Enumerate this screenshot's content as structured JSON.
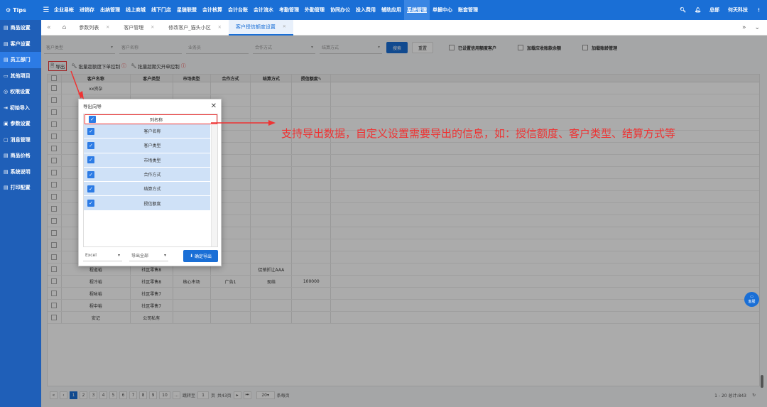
{
  "topbar": {
    "brand": "Tips",
    "nav": [
      "企业易帐",
      "进销存",
      "出纳管理",
      "线上商城",
      "线下门店",
      "星链联盟",
      "会计核算",
      "会计台账",
      "会计流水",
      "考勤管理",
      "外勤管理",
      "协同办公",
      "投入费用",
      "辅助应用",
      "系统管理",
      "单据中心",
      "账套管理"
    ],
    "active_nav": "系统管理",
    "user_role": "总部",
    "company": "何天科技"
  },
  "sidebar": {
    "items": [
      {
        "label": "商品设置"
      },
      {
        "label": "客户设置"
      },
      {
        "label": "员工部门"
      },
      {
        "label": "其他项目"
      },
      {
        "label": "权限设置"
      },
      {
        "label": "初始导入"
      },
      {
        "label": "参数设置"
      },
      {
        "label": "消息管理"
      },
      {
        "label": "商品价格"
      },
      {
        "label": "系统说明"
      },
      {
        "label": "打印配置"
      }
    ]
  },
  "tabs": [
    {
      "label": "参数列表"
    },
    {
      "label": "客户管理"
    },
    {
      "label": "修改客户_猫头小区"
    },
    {
      "label": "客户授信额度设置"
    }
  ],
  "filters": {
    "customer_type": "客户类型",
    "customer_name": "客户名称",
    "salesman": "业务员",
    "cooperation": "合作方式",
    "settlement": "结算方式",
    "search": "搜索",
    "reset": "重置",
    "opt1": "已设置信用额度客户",
    "opt2": "加载应收账款余额",
    "opt3": "加载账龄管理"
  },
  "toolbar": {
    "export": "导出",
    "batch1": "批量超额度下单控制",
    "batch2": "批量超期欠开单控制"
  },
  "grid": {
    "headers": [
      "客户名称",
      "客户类型",
      "市场类型",
      "合作方式",
      "结算方式",
      "授信额度✎"
    ],
    "rows": [
      [
        "xx资杂",
        "",
        "",
        "",
        "",
        ""
      ],
      [
        "",
        "",
        "",
        "",
        "",
        ""
      ],
      [
        "",
        "",
        "",
        "",
        "",
        ""
      ],
      [
        "",
        "",
        "",
        "",
        "",
        ""
      ],
      [
        "",
        "",
        "",
        "",
        "",
        ""
      ],
      [
        "",
        "",
        "",
        "",
        "",
        ""
      ],
      [
        "",
        "",
        "",
        "",
        "",
        ""
      ],
      [
        "",
        "",
        "",
        "",
        "",
        ""
      ],
      [
        "",
        "",
        "",
        "",
        "",
        ""
      ],
      [
        "",
        "",
        "",
        "",
        "",
        ""
      ],
      [
        "",
        "",
        "",
        "",
        "",
        ""
      ],
      [
        "",
        "",
        "",
        "",
        "",
        ""
      ],
      [
        "",
        "",
        "",
        "",
        "",
        ""
      ],
      [
        "",
        "",
        "",
        "",
        "",
        ""
      ],
      [
        "",
        "",
        "",
        "",
        "",
        ""
      ],
      [
        "程道裕",
        "社区零售8",
        "",
        "",
        "促销折让AAA",
        ""
      ],
      [
        "程冷裕",
        "社区零售8",
        "核心市场",
        "广告1",
        "现结",
        "100000"
      ],
      [
        "程咏裕",
        "社区零售7",
        "",
        "",
        "",
        ""
      ],
      [
        "程中裕",
        "社区零售7",
        "",
        "",
        "",
        ""
      ],
      [
        "安记",
        "公司私有",
        "",
        "",
        "",
        ""
      ]
    ]
  },
  "pager": {
    "pages": [
      "1",
      "2",
      "3",
      "4",
      "5",
      "6",
      "7",
      "8",
      "9",
      "10"
    ],
    "jump_label": "跳转至",
    "jump_value": "1",
    "page_unit": "页",
    "total_pages": "共43页",
    "page_size": "20",
    "per_page": "条每页",
    "summary": "1 - 20 总计:843"
  },
  "dialog": {
    "title": "导出向导",
    "header": "列名称",
    "columns": [
      "客户名称",
      "客户类型",
      "市场类型",
      "合作方式",
      "结算方式",
      "授信额度"
    ],
    "format": "Excel",
    "scope": "导出全部",
    "confirm": "确定导出"
  },
  "annotation": "支持导出数据，自定义设置需要导出的信息，如：授信额度、客户类型、结算方式等",
  "chat_label": "客服",
  "colors": {
    "primary": "#1a6fd6",
    "sidebar": "#1f5fb8",
    "annotation": "#e33333"
  }
}
